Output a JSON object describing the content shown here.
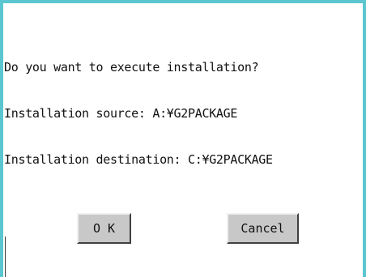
{
  "dialog": {
    "lines": [
      "Do you want to execute installation?",
      "Installation source: A:¥G2PACKAGE",
      "Installation destination: C:¥G2PACKAGE"
    ],
    "ok_label": "O K",
    "cancel_label": "Cancel"
  },
  "colors": {
    "frame": "#5bc6cf",
    "button_face": "#c8c8c8"
  }
}
